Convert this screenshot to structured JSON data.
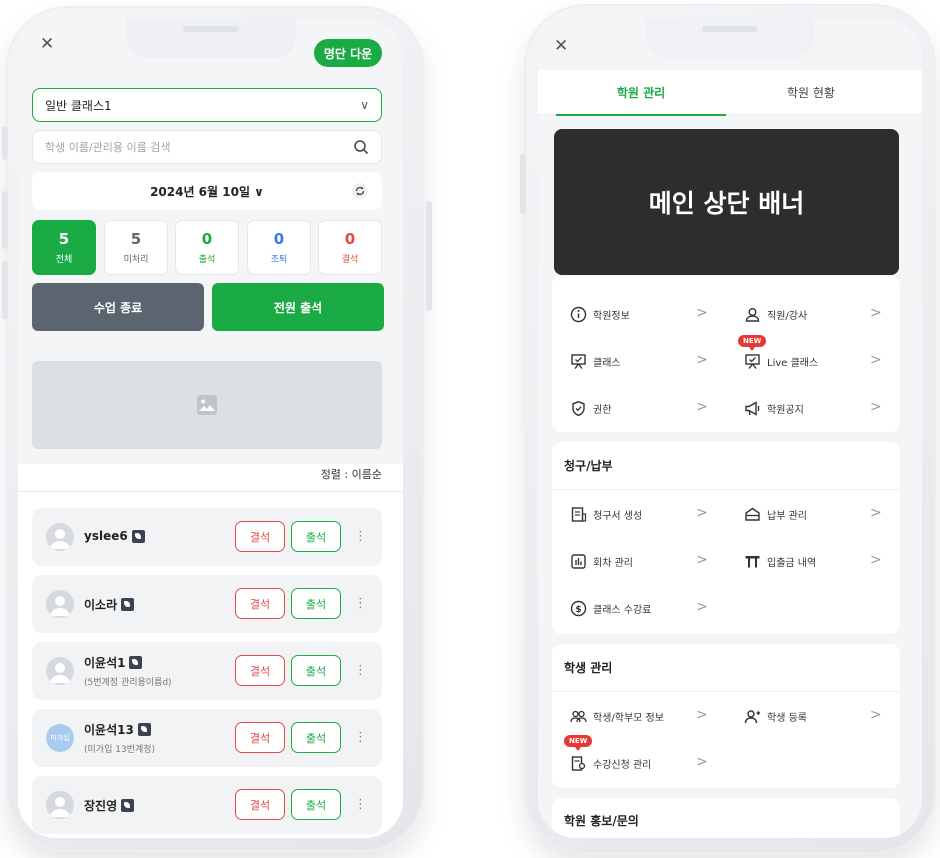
{
  "left_phone": {
    "close_icon": "close-icon",
    "download_button_label": "명단 다운",
    "class_select": {
      "value": "일반 클래스1"
    },
    "search": {
      "placeholder": "학생 이름/관리용 이름 검색"
    },
    "date_label": "2024년 6월 10일 ∨",
    "stats": [
      {
        "count": "5",
        "label": "전체",
        "color": "#ffffff"
      },
      {
        "count": "5",
        "label": "미처리",
        "color": "#666666"
      },
      {
        "count": "0",
        "label": "출석",
        "color": "#1aab44"
      },
      {
        "count": "0",
        "label": "조퇴",
        "color": "#3a7bea"
      },
      {
        "count": "0",
        "label": "결석",
        "color": "#e24a4a"
      }
    ],
    "end_class_label": "수업 종료",
    "all_attend_label": "전원 출석",
    "sort_label": "정렬 : 이름순",
    "students": [
      {
        "name": "yslee6",
        "sub": "",
        "avatar": "default"
      },
      {
        "name": "이소라",
        "sub": "",
        "avatar": "default"
      },
      {
        "name": "이윤석1",
        "sub": "(5번계정 관리용이름d)",
        "avatar": "default"
      },
      {
        "name": "이윤석13",
        "sub": "(미가입 13번계정)",
        "avatar": "tag",
        "avatar_text": "미가입"
      },
      {
        "name": "장진영",
        "sub": "",
        "avatar": "default"
      }
    ],
    "absent_label": "결석",
    "attend_label": "출석",
    "colors": {
      "brand": "#1aab44",
      "danger": "#e24a4a",
      "dark_button": "#5c6470"
    }
  },
  "right_phone": {
    "tabs": [
      {
        "label": "학원 관리",
        "active": true
      },
      {
        "label": "학원 현황",
        "active": false
      }
    ],
    "banner_text": "메인 상단 배너",
    "new_badge": "NEW",
    "menu1": [
      {
        "label": "학원정보",
        "icon": "info-icon"
      },
      {
        "label": "직원/강사",
        "icon": "person-icon"
      },
      {
        "label": "클래스",
        "icon": "board-icon"
      },
      {
        "label": "Live 클래스",
        "icon": "live-board-icon",
        "new": true
      },
      {
        "label": "권한",
        "icon": "shield-icon"
      },
      {
        "label": "학원공지",
        "icon": "megaphone-icon"
      }
    ],
    "billing": {
      "title": "청구/납부",
      "items": [
        {
          "label": "청구서 생성",
          "icon": "invoice-icon"
        },
        {
          "label": "납부 관리",
          "icon": "payment-icon"
        },
        {
          "label": "회차 관리",
          "icon": "chart-icon"
        },
        {
          "label": "입출금 내역",
          "icon": "bank-icon"
        },
        {
          "label": "클래스 수강료",
          "icon": "coin-icon"
        }
      ]
    },
    "students": {
      "title": "학생 관리",
      "items": [
        {
          "label": "학생/학부모 정보",
          "icon": "people-icon"
        },
        {
          "label": "학생 등록",
          "icon": "person-add-icon"
        },
        {
          "label": "수강신청 관리",
          "icon": "enroll-icon",
          "new": true
        }
      ]
    },
    "promo": {
      "title": "학원 홍보/문의"
    }
  }
}
